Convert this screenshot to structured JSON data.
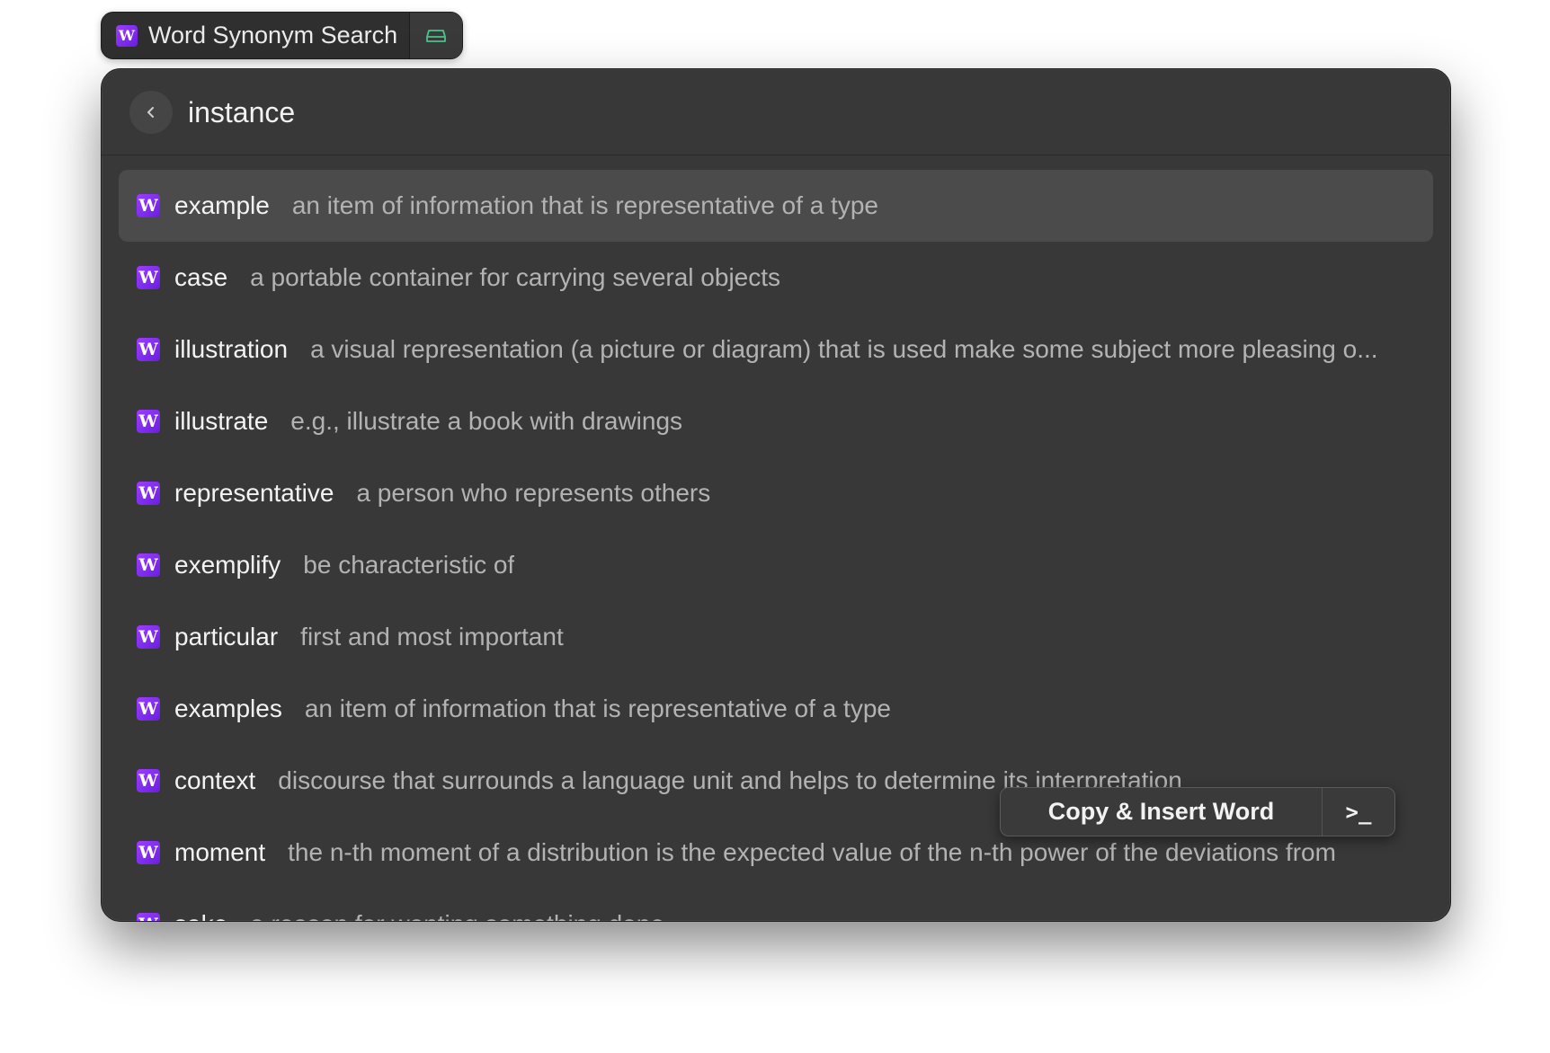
{
  "extension": {
    "title": "Word Synonym Search",
    "icon": "word-w-icon",
    "side_icon": "hard-drive-icon"
  },
  "search": {
    "value": "instance",
    "back_icon": "chevron-left-icon"
  },
  "results": [
    {
      "word": "example",
      "definition": "an item of information that is representative of a type",
      "selected": true
    },
    {
      "word": "case",
      "definition": "a portable container for carrying several objects"
    },
    {
      "word": "illustration",
      "definition": "a visual representation (a picture or diagram) that is used make some subject more pleasing o..."
    },
    {
      "word": "illustrate",
      "definition": "e.g., illustrate a book with drawings"
    },
    {
      "word": "representative",
      "definition": "a person who represents others"
    },
    {
      "word": "exemplify",
      "definition": "be characteristic of"
    },
    {
      "word": "particular",
      "definition": "first and most important"
    },
    {
      "word": "examples",
      "definition": "an item of information that is representative of a type"
    },
    {
      "word": "context",
      "definition": "discourse that surrounds a language unit and helps to determine its interpretation"
    },
    {
      "word": "moment",
      "definition": "the n-th moment of a distribution is the expected value of the n-th power of the deviations from"
    },
    {
      "word": "sake",
      "definition": "a reason for wanting something done"
    }
  ],
  "action_bar": {
    "primary_label": "Copy & Insert Word",
    "secondary_icon": "terminal-prompt-icon",
    "secondary_glyph": ">_"
  },
  "colors": {
    "accent": "#8a2be2",
    "window_bg": "#383838",
    "selected_row": "#4b4b4b",
    "drive_icon": "#4cc48a"
  }
}
